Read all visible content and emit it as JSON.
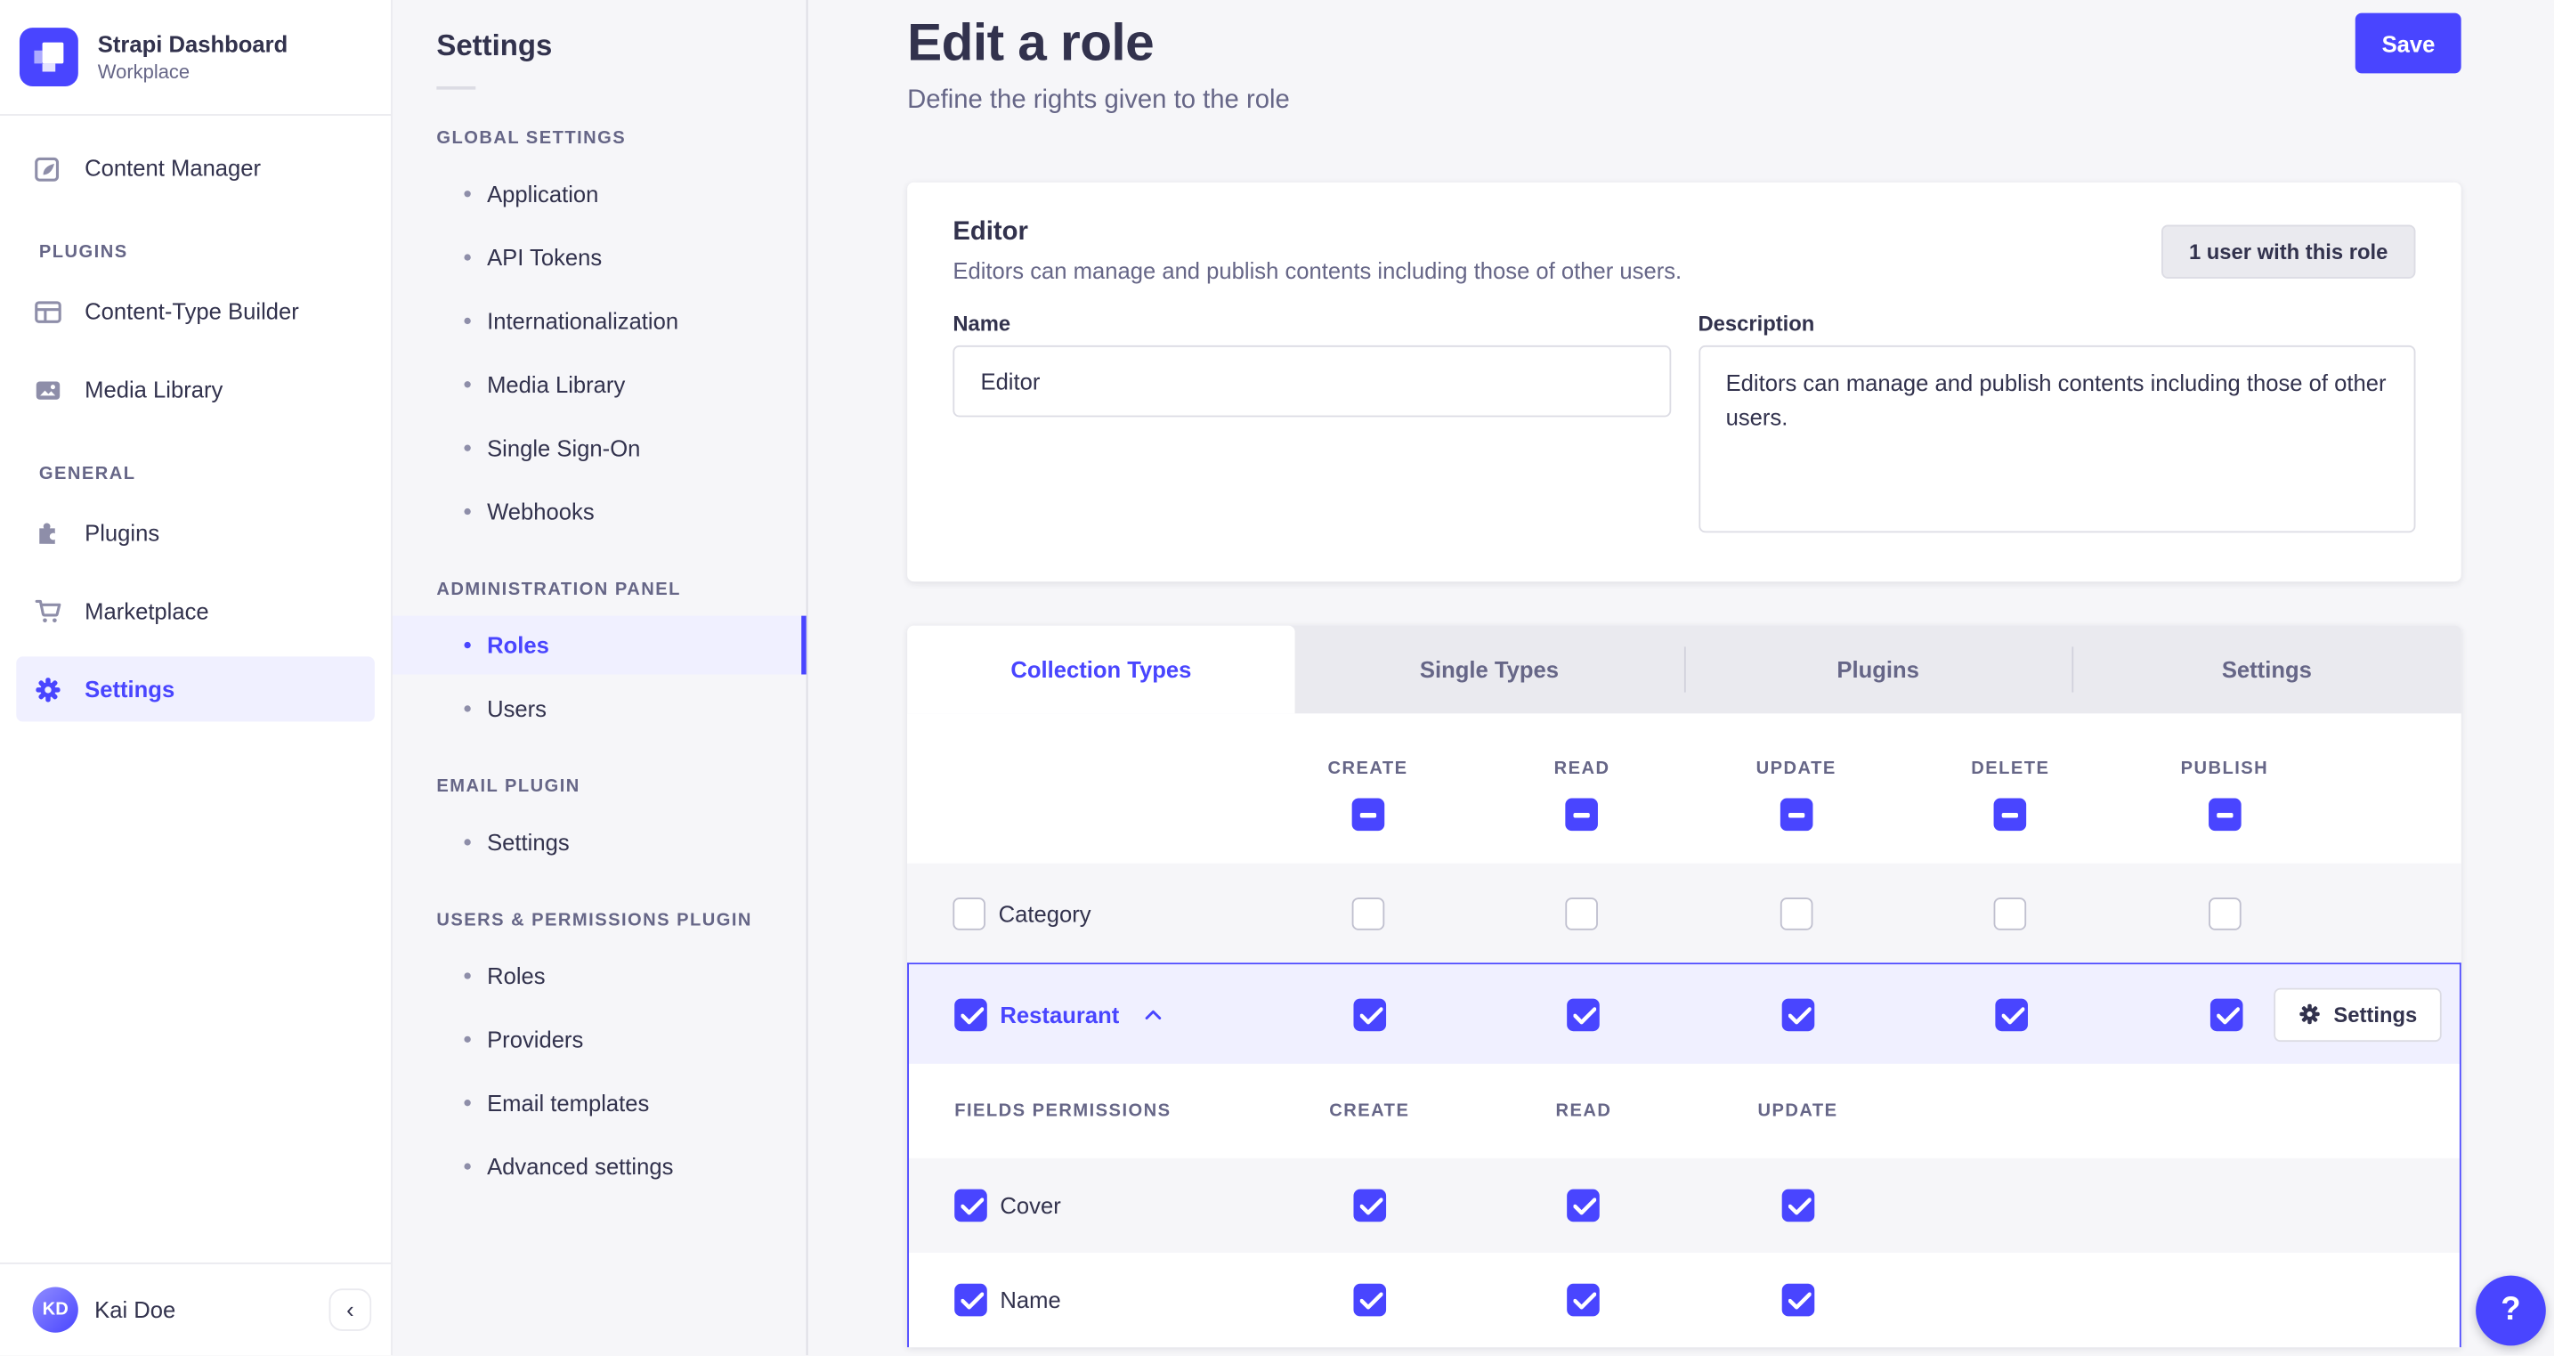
{
  "colors": {
    "accent": "#4945ff",
    "accent_bg": "#f0f0ff",
    "page_bg": "#f6f6f9",
    "text": "#32324d",
    "text_muted": "#666687",
    "border": "#dcdce4"
  },
  "app": {
    "name": "Strapi Dashboard",
    "workspace": "Workplace"
  },
  "nav": {
    "content_manager": "Content Manager",
    "sections": [
      {
        "label": "PLUGINS",
        "items": [
          {
            "icon": "layout-icon",
            "label": "Content-Type Builder"
          },
          {
            "icon": "image-icon",
            "label": "Media Library"
          }
        ]
      },
      {
        "label": "GENERAL",
        "items": [
          {
            "icon": "puzzle-icon",
            "label": "Plugins"
          },
          {
            "icon": "cart-icon",
            "label": "Marketplace"
          },
          {
            "icon": "gear-icon",
            "label": "Settings",
            "active": true
          }
        ]
      }
    ],
    "user": {
      "initials": "KD",
      "name": "Kai Doe"
    },
    "collapse_icon": "‹"
  },
  "subnav": {
    "title": "Settings",
    "sections": [
      {
        "label": "GLOBAL SETTINGS",
        "items": [
          "Application",
          "API Tokens",
          "Internationalization",
          "Media Library",
          "Single Sign-On",
          "Webhooks"
        ]
      },
      {
        "label": "ADMINISTRATION PANEL",
        "items": [
          "Roles",
          "Users"
        ],
        "active_item": "Roles"
      },
      {
        "label": "EMAIL PLUGIN",
        "items": [
          "Settings"
        ]
      },
      {
        "label": "USERS & PERMISSIONS PLUGIN",
        "items": [
          "Roles",
          "Providers",
          "Email templates",
          "Advanced settings"
        ]
      }
    ]
  },
  "header": {
    "title": "Edit a role",
    "subtitle": "Define the rights given to the role",
    "save_label": "Save"
  },
  "role_card": {
    "role_name": "Editor",
    "role_description": "Editors can manage and publish contents including those of other users.",
    "users_button": "1 user with this role",
    "name_label": "Name",
    "name_value": "Editor",
    "description_label": "Description",
    "description_value": "Editors can manage and publish contents including those of other users."
  },
  "tabs": [
    {
      "label": "Collection Types",
      "active": true
    },
    {
      "label": "Single Types",
      "active": false
    },
    {
      "label": "Plugins",
      "active": false
    },
    {
      "label": "Settings",
      "active": false
    }
  ],
  "permissions": {
    "columns": [
      "CREATE",
      "READ",
      "UPDATE",
      "DELETE",
      "PUBLISH"
    ],
    "header_state": "indeterminate",
    "rows": [
      {
        "name": "Category",
        "checked": false,
        "expanded": false,
        "cells": [
          false,
          false,
          false,
          false,
          false
        ]
      },
      {
        "name": "Restaurant",
        "checked": true,
        "expanded": true,
        "cells": [
          true,
          true,
          true,
          true,
          true
        ],
        "settings_label": "Settings"
      }
    ],
    "fields_section": {
      "header": "FIELDS PERMISSIONS",
      "columns": [
        "CREATE",
        "READ",
        "UPDATE"
      ],
      "rows": [
        {
          "name": "Cover",
          "checked": true,
          "cells": [
            true,
            true,
            true
          ]
        },
        {
          "name": "Name",
          "checked": true,
          "cells": [
            true,
            true,
            true
          ]
        }
      ]
    }
  },
  "help": {
    "label": "?"
  }
}
